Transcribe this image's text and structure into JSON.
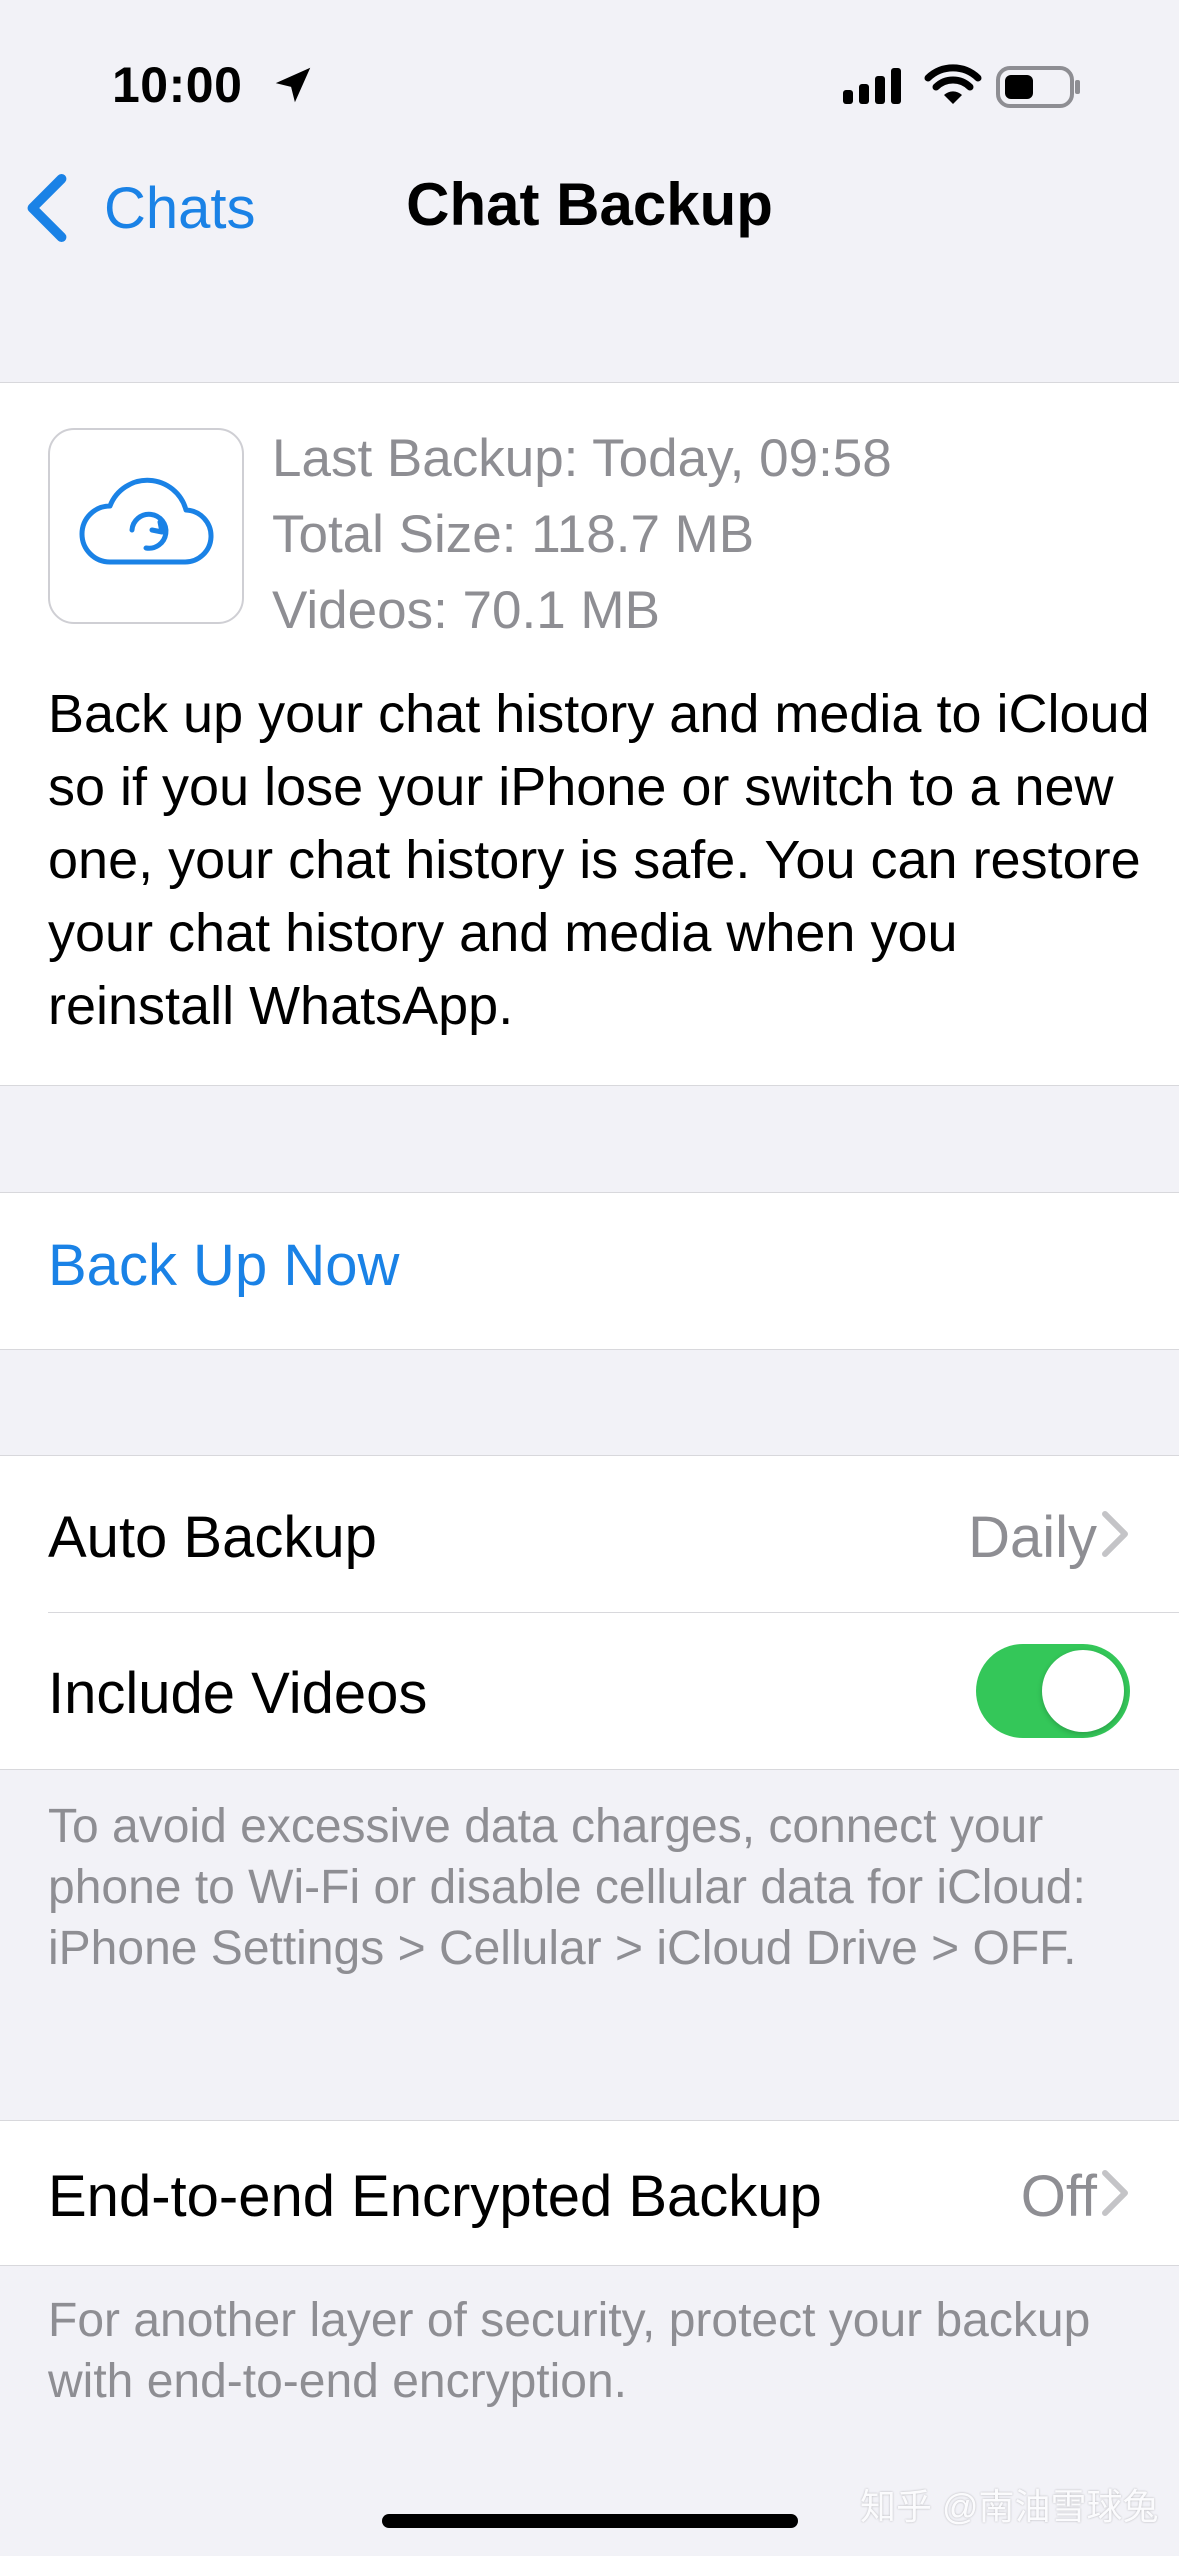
{
  "status_bar": {
    "time": "10:00"
  },
  "nav": {
    "back_label": "Chats",
    "title": "Chat Backup"
  },
  "backup_info": {
    "last_backup": "Last Backup: Today, 09:58",
    "total_size": "Total Size: 118.7 MB",
    "videos": "Videos: 70.1 MB",
    "description": "Back up your chat history and media to iCloud so if you lose your iPhone or switch to a new one, your chat history is safe. You can restore your chat history and media when you reinstall WhatsApp."
  },
  "actions": {
    "back_up_now": "Back Up Now"
  },
  "settings": {
    "auto_backup": {
      "label": "Auto Backup",
      "value": "Daily"
    },
    "include_videos": {
      "label": "Include Videos",
      "enabled": true
    },
    "videos_note": "To avoid excessive data charges, connect your phone to Wi-Fi or disable cellular data for iCloud: iPhone Settings > Cellular > iCloud Drive > OFF.",
    "e2e_backup": {
      "label": "End-to-end Encrypted Backup",
      "value": "Off"
    },
    "e2e_note": "For another layer of security, protect your backup with end-to-end encryption."
  },
  "watermark": "知乎 @南油雪球兔",
  "colors": {
    "accent": "#1a82e6",
    "toggle_on": "#34C759",
    "secondary_text": "#8e8e93",
    "background": "#F2F2F7"
  }
}
